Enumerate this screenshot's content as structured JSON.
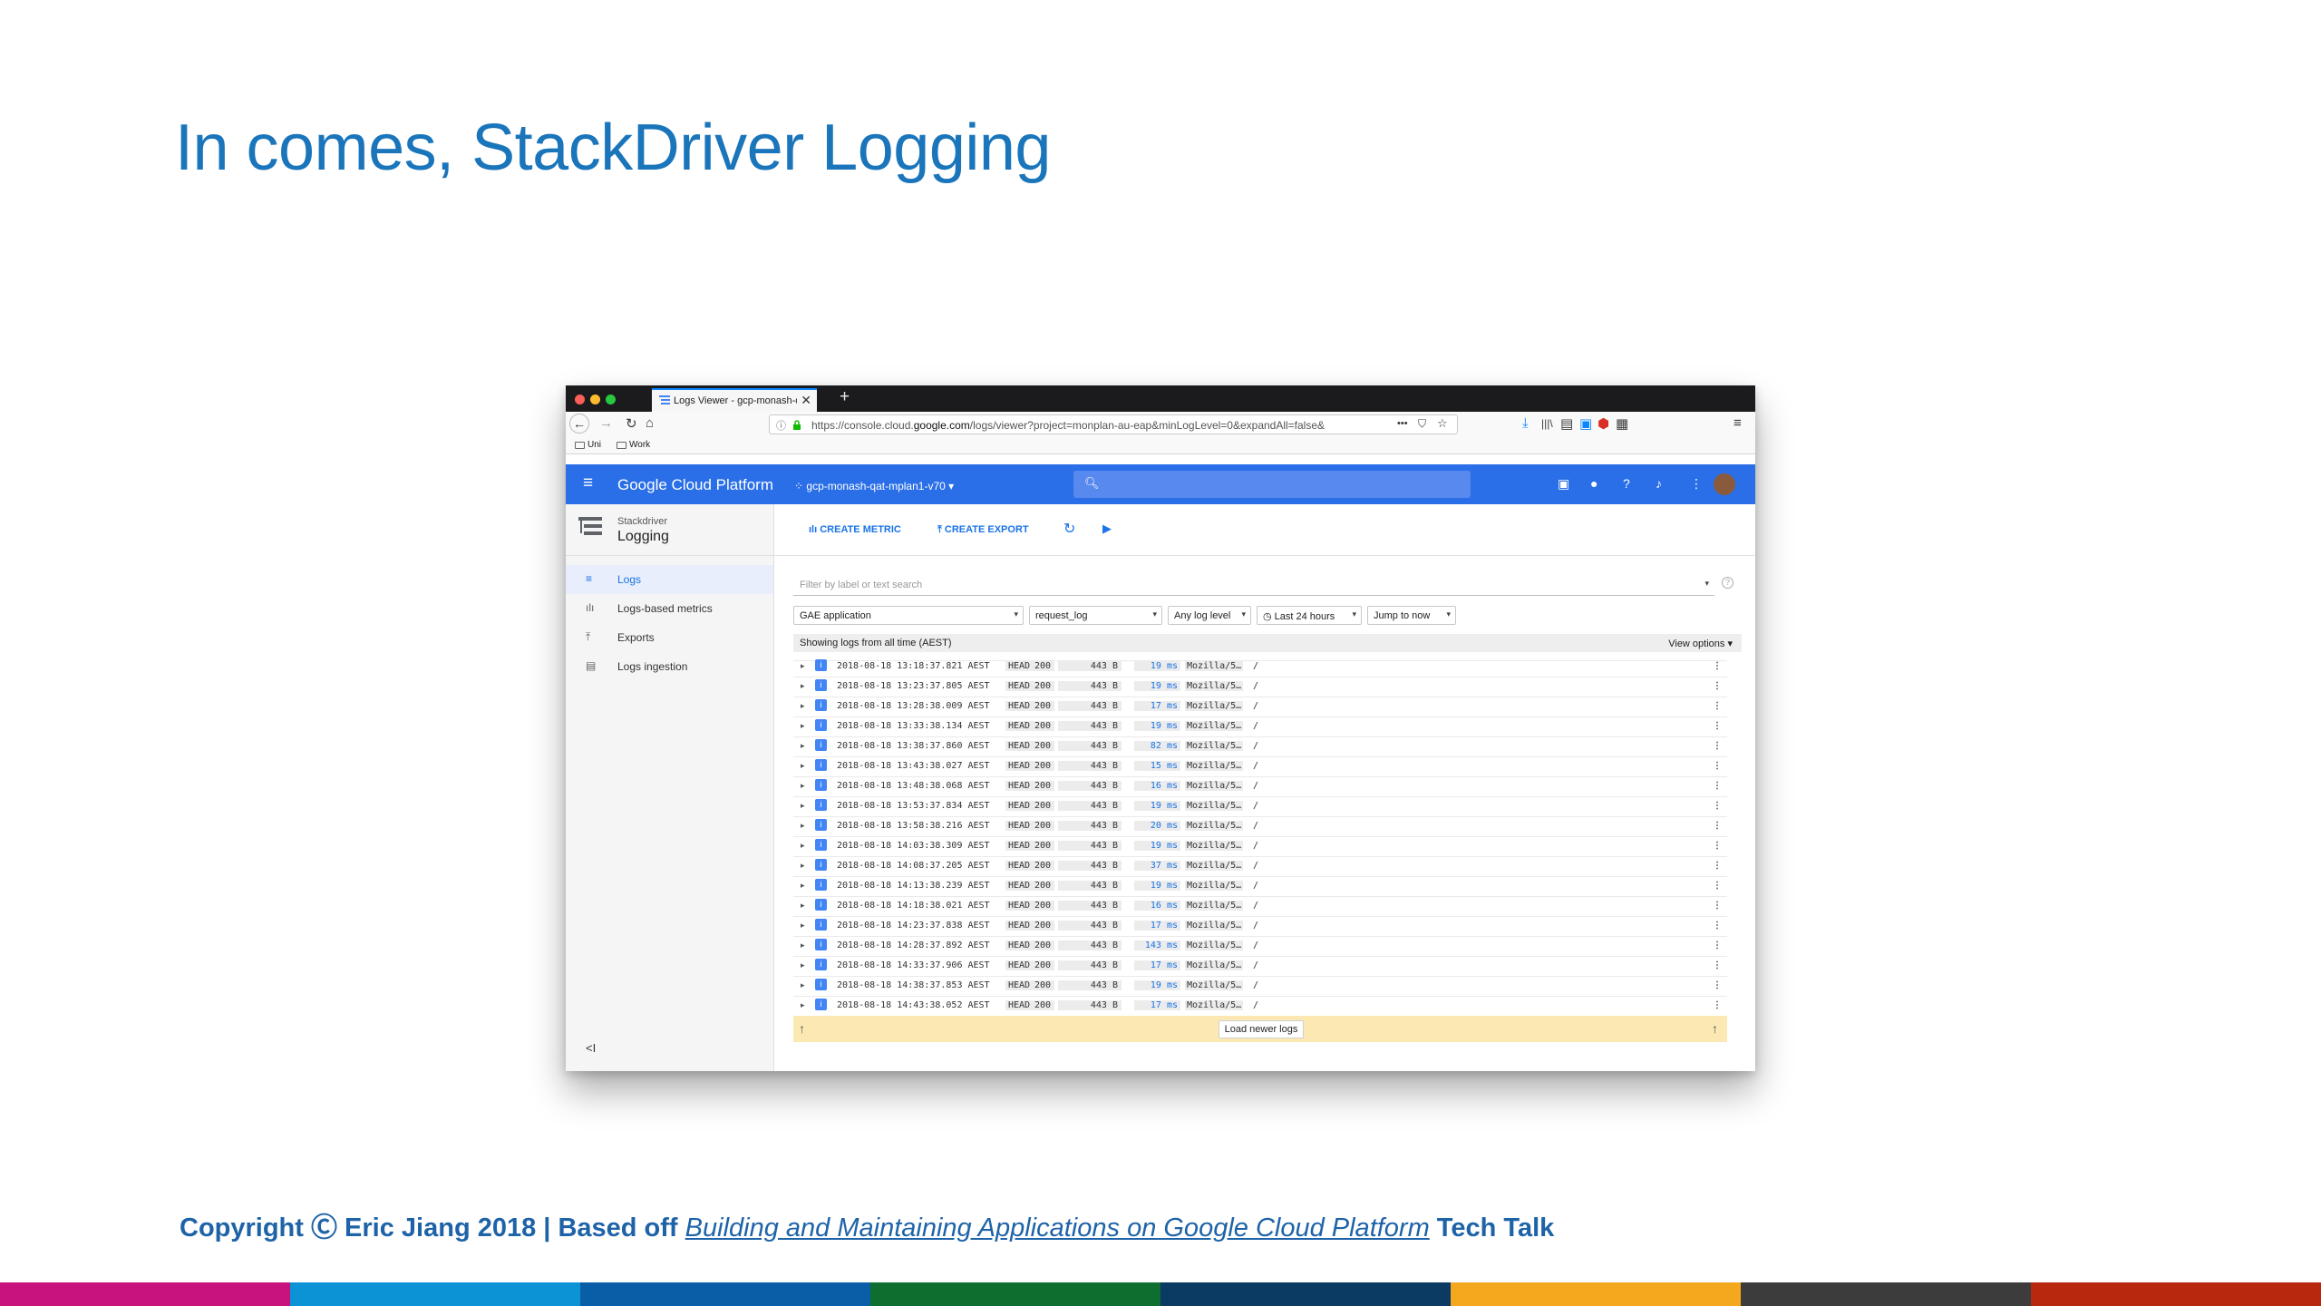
{
  "slide": {
    "title": "In comes, StackDriver Logging",
    "footer_prefix": "Copyright Ⓒ Eric Jiang 2018 | Based off ",
    "footer_link": "Building and Maintaining Applications on Google Cloud Platform",
    "footer_suffix": " Tech Talk",
    "bar_colors": [
      "#c8137d",
      "#0b93d6",
      "#0a5ea8",
      "#0d6e2f",
      "#0b3a63",
      "#f4a81d",
      "#3c3c3c",
      "#b8280f"
    ]
  },
  "browser": {
    "tab_title": "Logs Viewer - gcp-monash-qat-",
    "tab_close": "✕",
    "new_tab": "+",
    "url_prefix": "https://console.cloud.",
    "url_domain": "google.com",
    "url_rest": "/logs/viewer?project=monplan-au-eap&minLogLevel=0&expandAll=false&",
    "url_more": "•••",
    "bookmarks": [
      "Uni",
      "Work"
    ]
  },
  "gcp": {
    "brand": "Google Cloud Platform",
    "project": "gcp-monash-qat-mplan1-v70"
  },
  "sidebar": {
    "product_small": "Stackdriver",
    "product_big": "Logging",
    "items": [
      {
        "label": "Logs",
        "icon": "list-icon"
      },
      {
        "label": "Logs-based metrics",
        "icon": "bar-chart-icon"
      },
      {
        "label": "Exports",
        "icon": "export-icon"
      },
      {
        "label": "Logs ingestion",
        "icon": "ingestion-icon"
      }
    ],
    "collapse": "<I"
  },
  "toolbar": {
    "create_metric": "CREATE METRIC",
    "create_export": "CREATE EXPORT"
  },
  "filters": {
    "search_placeholder": "Filter by label or text search",
    "resource": "GAE application",
    "log": "request_log",
    "level": "Any log level",
    "time": "Last 24 hours",
    "jump": "Jump to now"
  },
  "logs": {
    "showing": "Showing logs from all time (AEST)",
    "view_options": "View options",
    "rows": [
      {
        "ts": "2018-08-18 13:18:37.821 AEST",
        "method": "HEAD",
        "status": "200",
        "size": "443 B",
        "latency": "19 ms",
        "ua": "Mozilla/5…",
        "path": "/"
      },
      {
        "ts": "2018-08-18 13:23:37.805 AEST",
        "method": "HEAD",
        "status": "200",
        "size": "443 B",
        "latency": "19 ms",
        "ua": "Mozilla/5…",
        "path": "/"
      },
      {
        "ts": "2018-08-18 13:28:38.009 AEST",
        "method": "HEAD",
        "status": "200",
        "size": "443 B",
        "latency": "17 ms",
        "ua": "Mozilla/5…",
        "path": "/"
      },
      {
        "ts": "2018-08-18 13:33:38.134 AEST",
        "method": "HEAD",
        "status": "200",
        "size": "443 B",
        "latency": "19 ms",
        "ua": "Mozilla/5…",
        "path": "/"
      },
      {
        "ts": "2018-08-18 13:38:37.860 AEST",
        "method": "HEAD",
        "status": "200",
        "size": "443 B",
        "latency": "82 ms",
        "ua": "Mozilla/5…",
        "path": "/"
      },
      {
        "ts": "2018-08-18 13:43:38.027 AEST",
        "method": "HEAD",
        "status": "200",
        "size": "443 B",
        "latency": "15 ms",
        "ua": "Mozilla/5…",
        "path": "/"
      },
      {
        "ts": "2018-08-18 13:48:38.068 AEST",
        "method": "HEAD",
        "status": "200",
        "size": "443 B",
        "latency": "16 ms",
        "ua": "Mozilla/5…",
        "path": "/"
      },
      {
        "ts": "2018-08-18 13:53:37.834 AEST",
        "method": "HEAD",
        "status": "200",
        "size": "443 B",
        "latency": "19 ms",
        "ua": "Mozilla/5…",
        "path": "/"
      },
      {
        "ts": "2018-08-18 13:58:38.216 AEST",
        "method": "HEAD",
        "status": "200",
        "size": "443 B",
        "latency": "20 ms",
        "ua": "Mozilla/5…",
        "path": "/"
      },
      {
        "ts": "2018-08-18 14:03:38.309 AEST",
        "method": "HEAD",
        "status": "200",
        "size": "443 B",
        "latency": "19 ms",
        "ua": "Mozilla/5…",
        "path": "/"
      },
      {
        "ts": "2018-08-18 14:08:37.205 AEST",
        "method": "HEAD",
        "status": "200",
        "size": "443 B",
        "latency": "37 ms",
        "ua": "Mozilla/5…",
        "path": "/"
      },
      {
        "ts": "2018-08-18 14:13:38.239 AEST",
        "method": "HEAD",
        "status": "200",
        "size": "443 B",
        "latency": "19 ms",
        "ua": "Mozilla/5…",
        "path": "/"
      },
      {
        "ts": "2018-08-18 14:18:38.021 AEST",
        "method": "HEAD",
        "status": "200",
        "size": "443 B",
        "latency": "16 ms",
        "ua": "Mozilla/5…",
        "path": "/"
      },
      {
        "ts": "2018-08-18 14:23:37.838 AEST",
        "method": "HEAD",
        "status": "200",
        "size": "443 B",
        "latency": "17 ms",
        "ua": "Mozilla/5…",
        "path": "/"
      },
      {
        "ts": "2018-08-18 14:28:37.892 AEST",
        "method": "HEAD",
        "status": "200",
        "size": "443 B",
        "latency": "143 ms",
        "ua": "Mozilla/5…",
        "path": "/"
      },
      {
        "ts": "2018-08-18 14:33:37.906 AEST",
        "method": "HEAD",
        "status": "200",
        "size": "443 B",
        "latency": "17 ms",
        "ua": "Mozilla/5…",
        "path": "/"
      },
      {
        "ts": "2018-08-18 14:38:37.853 AEST",
        "method": "HEAD",
        "status": "200",
        "size": "443 B",
        "latency": "19 ms",
        "ua": "Mozilla/5…",
        "path": "/"
      },
      {
        "ts": "2018-08-18 14:43:38.052 AEST",
        "method": "HEAD",
        "status": "200",
        "size": "443 B",
        "latency": "17 ms",
        "ua": "Mozilla/5…",
        "path": "/"
      }
    ],
    "load_newer": "Load newer logs",
    "severity_glyph": "i"
  }
}
